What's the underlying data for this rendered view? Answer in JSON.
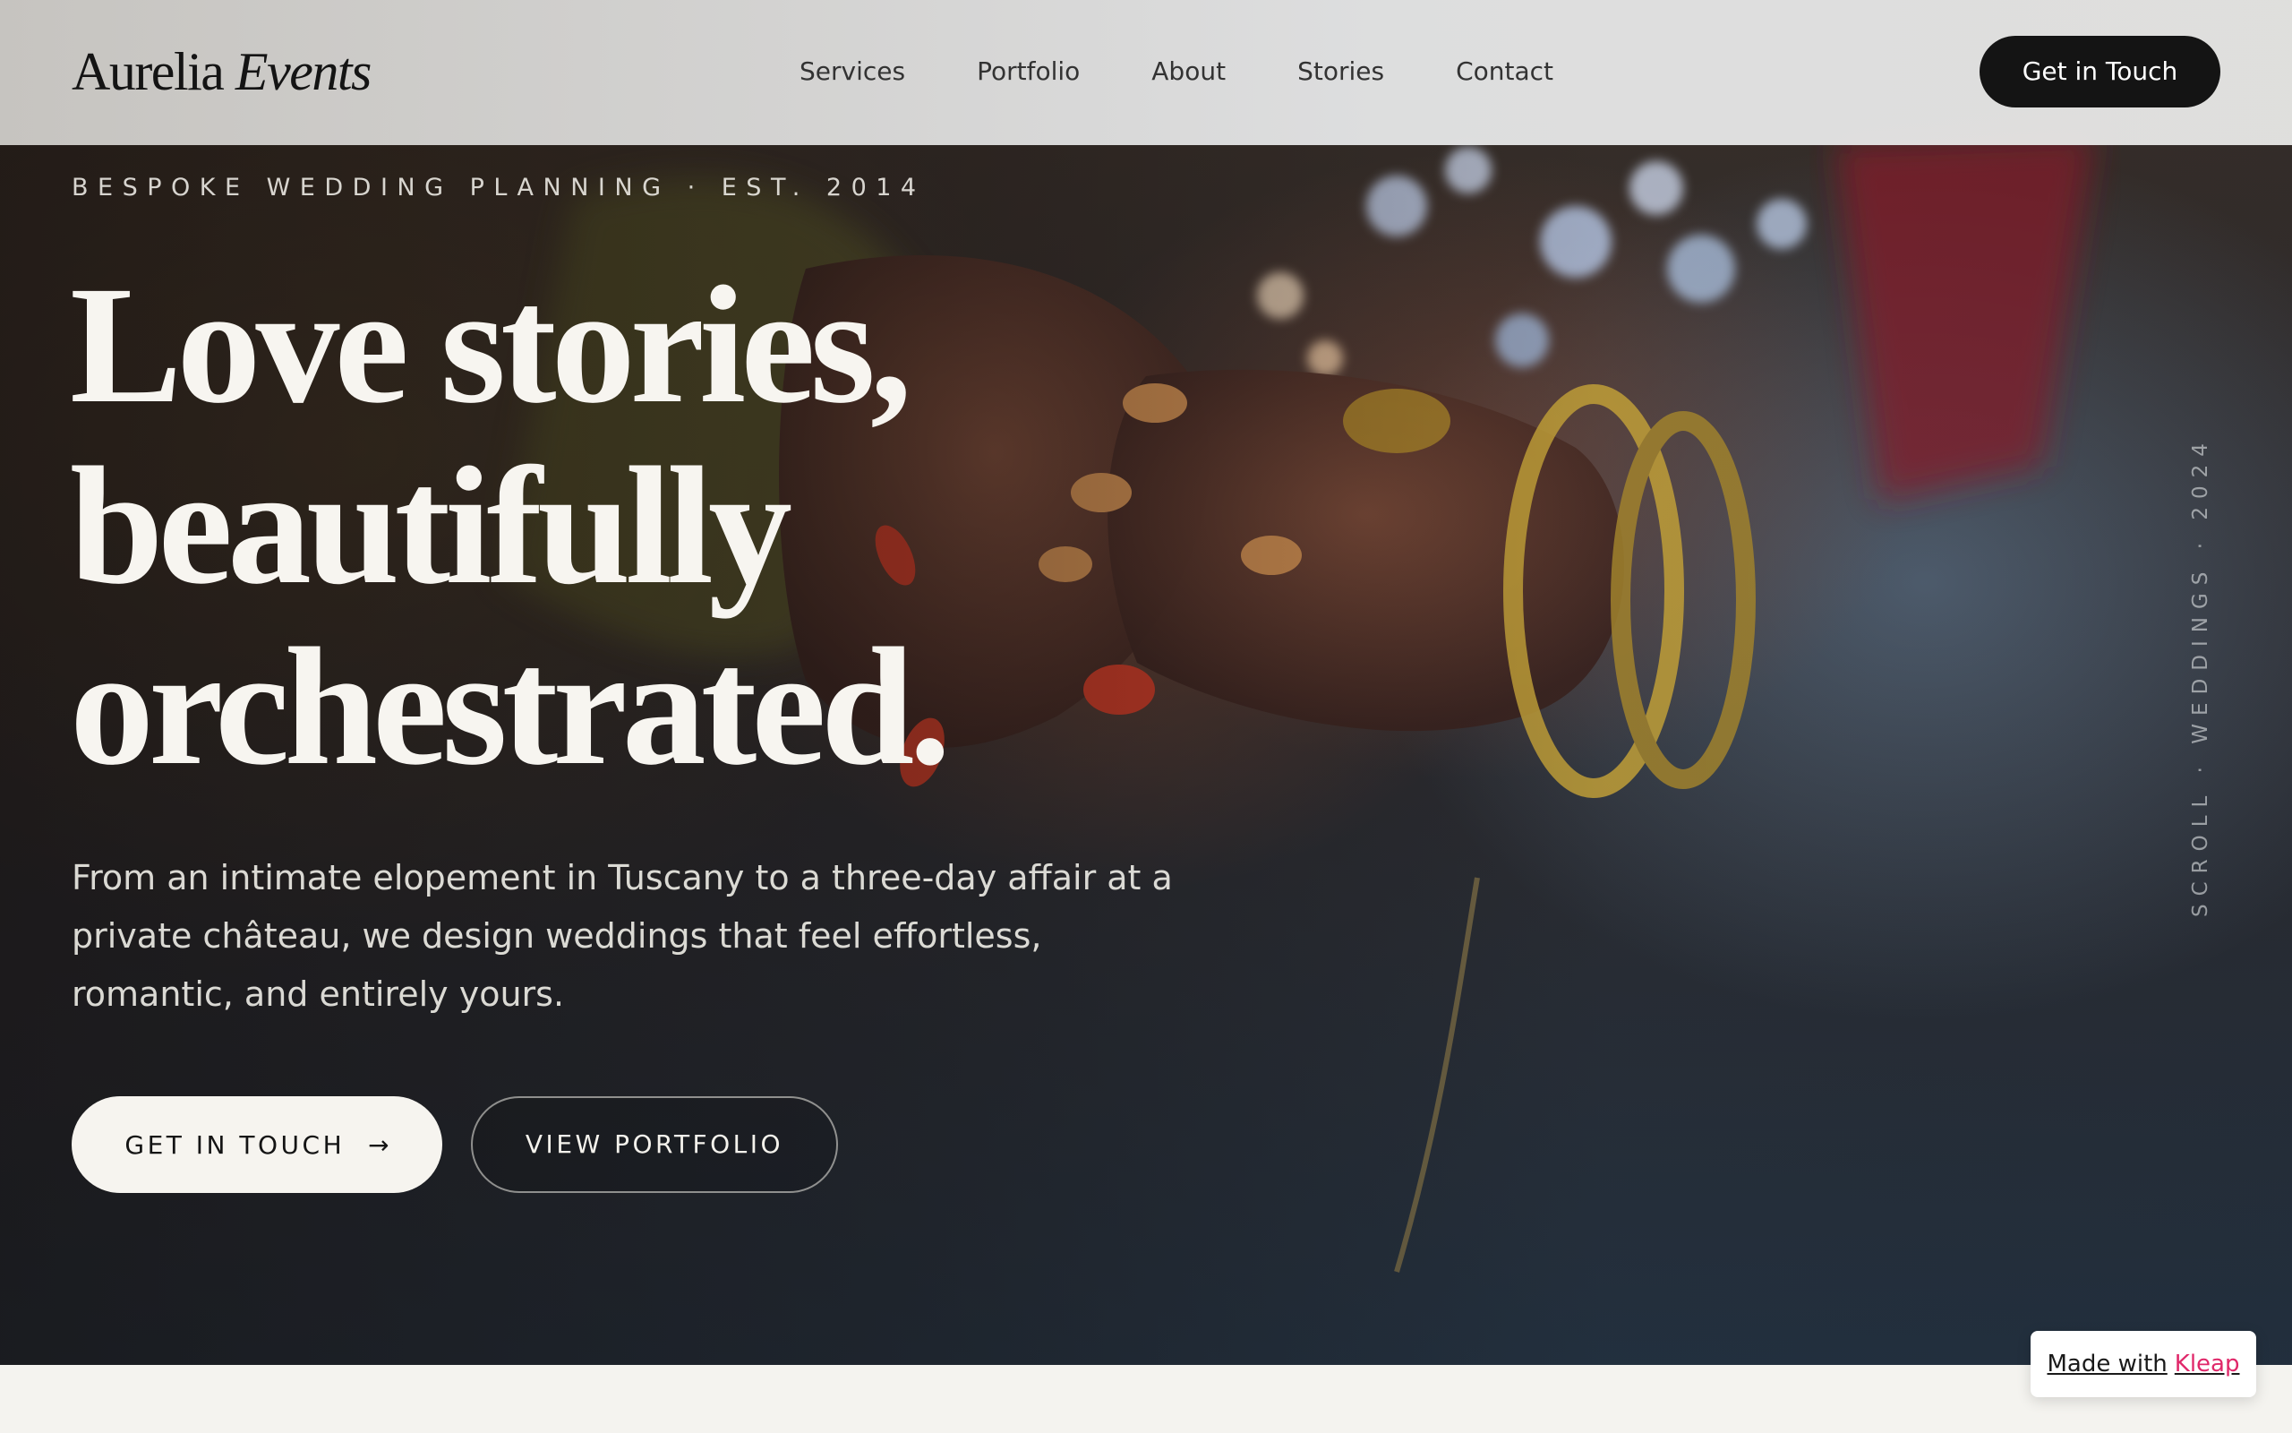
{
  "header": {
    "brand": {
      "name": "Aurelia",
      "name_italic": "Events"
    },
    "nav": [
      "Services",
      "Portfolio",
      "About",
      "Stories",
      "Contact"
    ],
    "cta_label": "Get in Touch"
  },
  "hero": {
    "eyebrow": "BESPOKE WEDDING PLANNING · EST. 2014",
    "headline": [
      "Love stories,",
      "beautifully",
      "orchestrated."
    ],
    "lede": "From an intimate elopement in Tuscany to a three-day affair at a private château, we design weddings that feel effortless, romantic, and entirely yours.",
    "primary_cta": "GET IN TOUCH",
    "primary_cta_icon": "arrow-right-icon",
    "secondary_cta": "VIEW PORTFOLIO",
    "vertical_label": "SCROLL · WEDDINGS · 2024",
    "background_image": "wedding-hands-mehndi-photo"
  },
  "badge": {
    "prefix": "Made with",
    "brand": "Kleap"
  },
  "colors": {
    "header_bg": "#e2e3e3",
    "dark": "#141414",
    "cream": "#f6f4ef",
    "kleap_pink": "#e0286a",
    "page_bg": "#f4f3ef"
  }
}
